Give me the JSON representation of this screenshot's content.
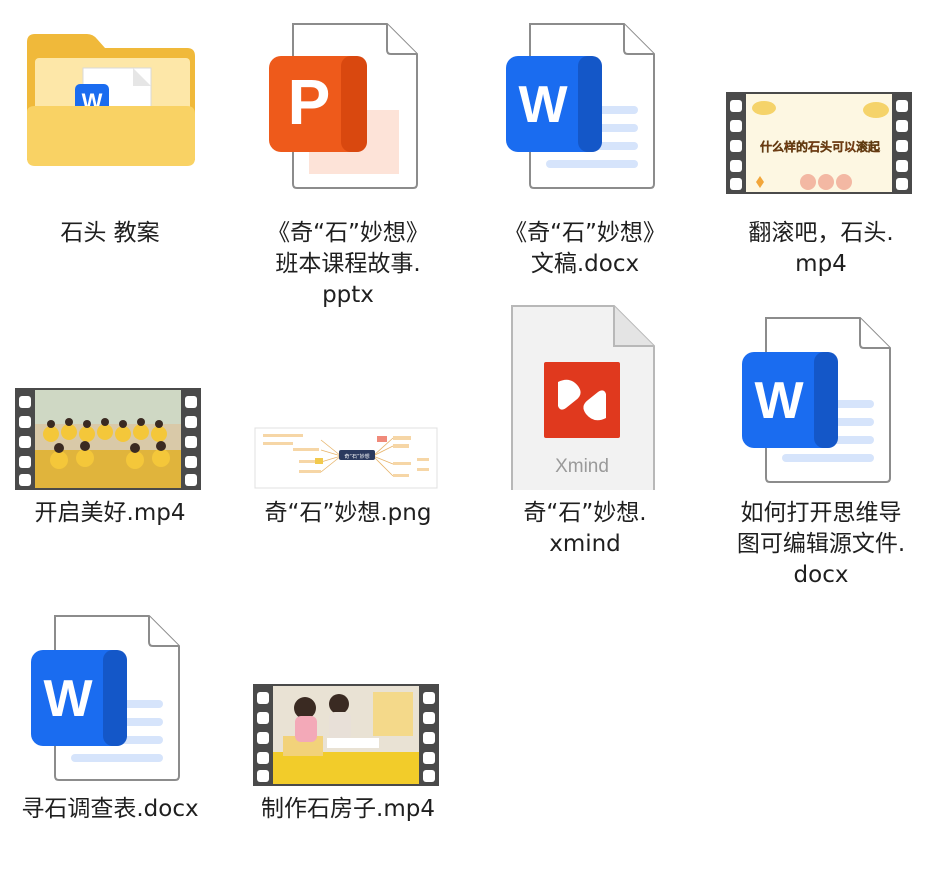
{
  "files": [
    {
      "lines": [
        "石头 教案"
      ],
      "kind": "folder",
      "icon": "folder-icon"
    },
    {
      "lines": [
        "《奇“石”妙想》",
        "班本课程故事.",
        "pptx"
      ],
      "kind": "pptx",
      "icon": "powerpoint-file-icon",
      "badge": "P"
    },
    {
      "lines": [
        "《奇“石”妙想》",
        "文稿.docx"
      ],
      "kind": "docx",
      "icon": "word-file-icon",
      "badge": "W"
    },
    {
      "lines": [
        "翻滚吧，石头.",
        "mp4"
      ],
      "kind": "video",
      "icon": "video-thumbnail",
      "frame_text": "什么样的石头可以滚起"
    },
    {
      "lines": [
        "开启美好.mp4"
      ],
      "kind": "video",
      "icon": "video-thumbnail"
    },
    {
      "lines": [
        "奇“石”妙想.png"
      ],
      "kind": "png",
      "icon": "mindmap-image-thumbnail",
      "center_node": "奇“石”妙想"
    },
    {
      "lines": [
        "奇“石”妙想.",
        "xmind"
      ],
      "kind": "xmind",
      "icon": "xmind-file-icon",
      "brand": "Xmind"
    },
    {
      "lines": [
        "如何打开思维导",
        "图可编辑源文件.",
        "docx"
      ],
      "kind": "docx",
      "icon": "word-file-icon",
      "badge": "W"
    },
    {
      "lines": [
        "寻石调查表.docx"
      ],
      "kind": "docx",
      "icon": "word-file-icon",
      "badge": "W"
    },
    {
      "lines": [
        "制作石房子.mp4"
      ],
      "kind": "video",
      "icon": "video-thumbnail"
    }
  ],
  "colors": {
    "word_blue": "#1a6cf0",
    "ppt_orange": "#ee5a1b",
    "xmind_red": "#e0391e",
    "folder_yellow": "#f7c54a",
    "film_gray": "#4a4a4a"
  }
}
